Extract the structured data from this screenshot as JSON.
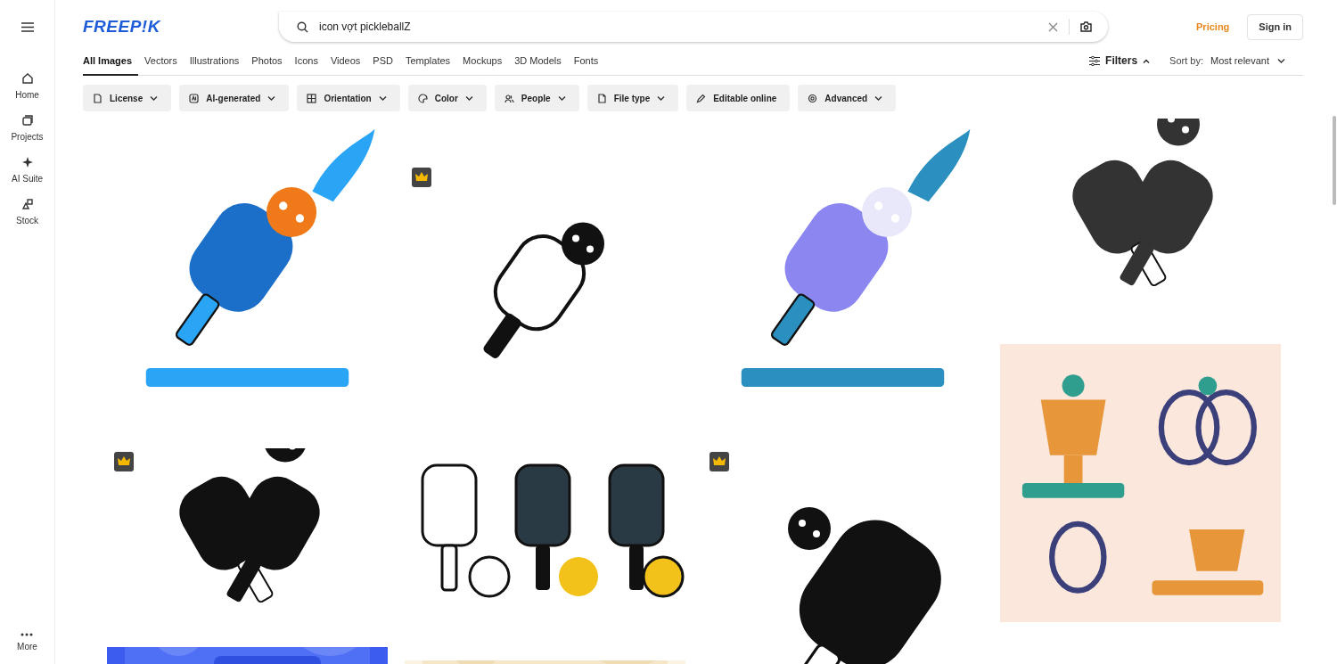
{
  "sidebar": {
    "items": [
      {
        "label": "Home",
        "selected": false
      },
      {
        "label": "Projects",
        "selected": false
      },
      {
        "label": "AI Suite",
        "selected": false
      },
      {
        "label": "Stock",
        "selected": false
      }
    ],
    "more": {
      "label": "More"
    }
  },
  "header": {
    "logo": "FREEP!K",
    "search": {
      "value": "icon vợt pickleballZ"
    },
    "pricing": "Pricing",
    "sign_in": "Sign in"
  },
  "tabs": [
    {
      "label": "All Images",
      "selected": true
    },
    {
      "label": "Vectors",
      "selected": false
    },
    {
      "label": "Illustrations",
      "selected": false
    },
    {
      "label": "Photos",
      "selected": false
    },
    {
      "label": "Icons",
      "selected": false
    },
    {
      "label": "Videos",
      "selected": false
    },
    {
      "label": "PSD",
      "selected": false
    },
    {
      "label": "Templates",
      "selected": false
    },
    {
      "label": "Mockups",
      "selected": false
    },
    {
      "label": "3D Models",
      "selected": false
    },
    {
      "label": "Fonts",
      "selected": false
    }
  ],
  "filters": {
    "label": "Filters",
    "expanded": true
  },
  "sort": {
    "label": "Sort by:",
    "value": "Most relevant"
  },
  "chips": [
    {
      "label": "License",
      "dropdown": true
    },
    {
      "label": "AI-generated",
      "dropdown": true
    },
    {
      "label": "Orientation",
      "dropdown": true
    },
    {
      "label": "Color",
      "dropdown": true
    },
    {
      "label": "People",
      "dropdown": true
    },
    {
      "label": "File type",
      "dropdown": true
    },
    {
      "label": "Editable online",
      "dropdown": false
    },
    {
      "label": "Advanced",
      "dropdown": true
    }
  ],
  "results": {
    "columns": [
      {
        "tiles": [
          {
            "kind": "picture",
            "premium": false
          },
          {
            "kind": "picture",
            "premium": true
          },
          {
            "kind": "picture",
            "premium": false
          }
        ]
      },
      {
        "tiles": [
          {
            "kind": "picture",
            "premium": true
          },
          {
            "kind": "picture",
            "premium": false
          },
          {
            "kind": "picture"
          }
        ]
      },
      {
        "tiles": [
          {
            "kind": "picture",
            "premium": false
          },
          {
            "kind": "picture",
            "premium": true
          }
        ]
      },
      {
        "tiles": [
          {
            "kind": "picture",
            "premium": false
          },
          {
            "kind": "picture",
            "premium": false
          }
        ]
      }
    ]
  }
}
